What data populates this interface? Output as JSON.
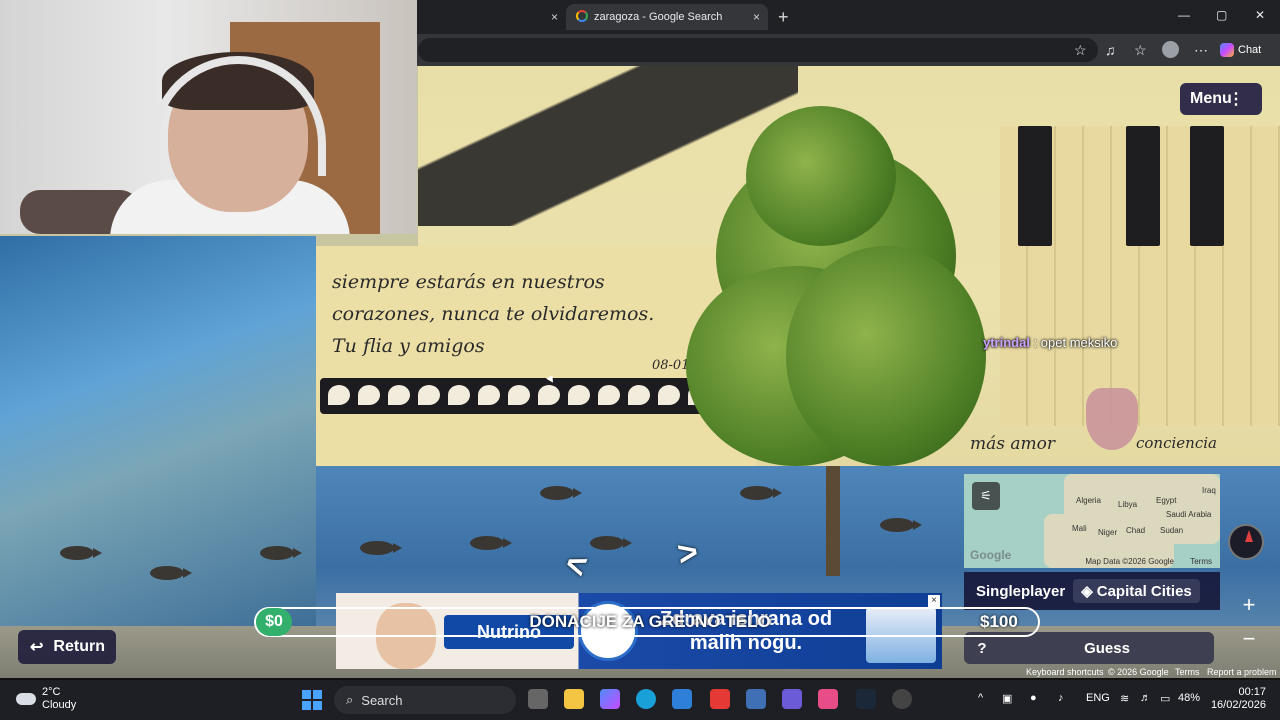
{
  "browser": {
    "tab_active": "zaragoza - Google Search",
    "chat_label": "Chat",
    "new_tab": "+",
    "close": "×",
    "win_min": "—",
    "win_max": "▢",
    "win_close": "✕"
  },
  "street_view": {
    "mural_text": "siempre estarás en nuestros corazones, nunca te olvidaremos. Tu flia y amigos",
    "mural_date": "08-01-2",
    "mural_text_2": "más amor",
    "mural_text_3": "conciencia"
  },
  "game": {
    "menu_label": "Menu",
    "menu_dots": "⋮",
    "chat_user": "ytrindal",
    "chat_message": " : opet meksiko",
    "mode": "Singleplayer",
    "map_name": "Capital Cities",
    "guess_label": "Guess",
    "help_label": "?",
    "return_label": "Return",
    "zoom_in": "+",
    "zoom_out": "−",
    "map": {
      "google_logo": "Google",
      "data_credit": "Map Data ©2026 Google",
      "terms": "Terms",
      "labels": [
        "Algeria",
        "Libya",
        "Egypt",
        "Iraq",
        "Saudi Arabia",
        "Mali",
        "Niger",
        "Chad",
        "Sudan"
      ]
    },
    "attribution": {
      "shortcuts": "Keyboard shortcuts",
      "copyright": "© 2026 Google",
      "terms": "Terms",
      "report": "Report a problem"
    }
  },
  "donation": {
    "current": "$0",
    "title": "DONACIJE ZA GREJNO TELO",
    "goal": "$100",
    "progress": 0
  },
  "ad": {
    "brand": "Nutrino",
    "slogan": "Zdrava ishrana od malih nogu."
  },
  "taskbar": {
    "temperature": "2°C",
    "condition": "Cloudy",
    "search_label": "Search",
    "language": "ENG",
    "battery": "48%",
    "time": "00:17",
    "date": "16/02/2026"
  }
}
